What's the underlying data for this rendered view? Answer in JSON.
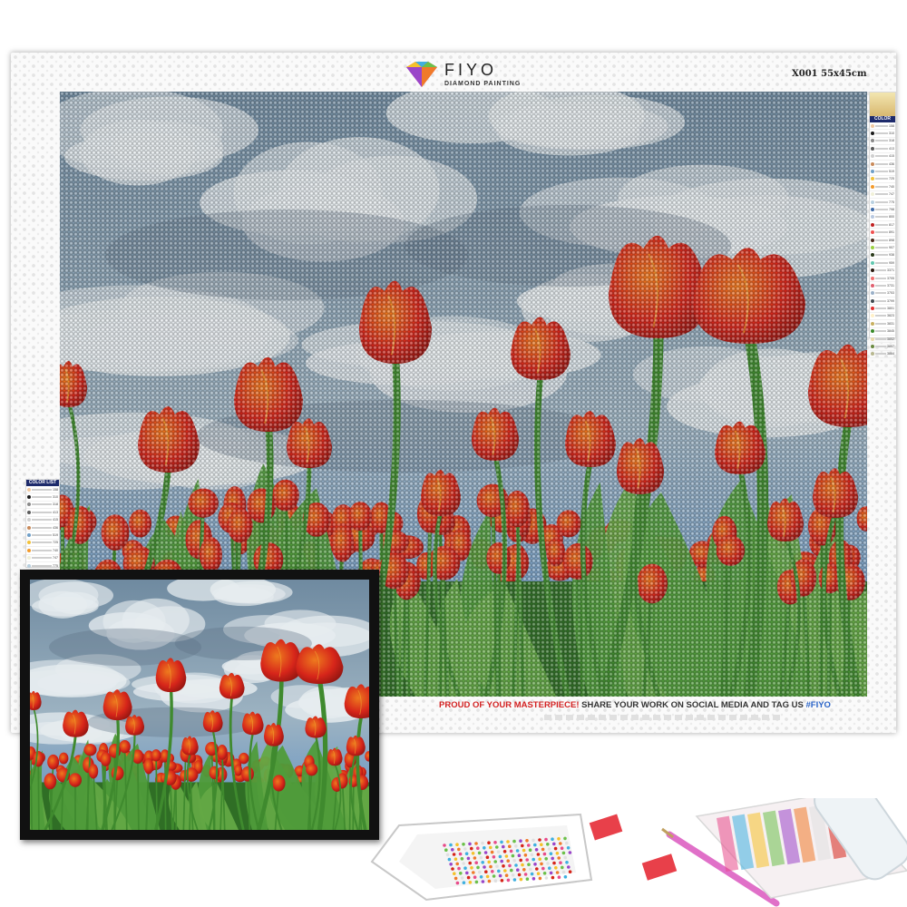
{
  "brand": {
    "name": "FIYO",
    "tagline": "DIAMOND PAINTING"
  },
  "canvas": {
    "size_label": "X001 55x45cm"
  },
  "footer": {
    "part1": "PROUD OF YOUR MASTERPIECE!",
    "part2": " SHARE YOUR WORK ON SOCIAL MEDIA AND TAG US ",
    "part3": "#FIYO"
  },
  "color_list": {
    "title": "COLOR LIST",
    "codes": [
      "158",
      "310",
      "318",
      "413",
      "415",
      "436",
      "519",
      "725",
      "740",
      "747",
      "775",
      "798",
      "800",
      "817",
      "891",
      "898",
      "907",
      "938",
      "959",
      "3371",
      "3705",
      "3731",
      "3753",
      "3799",
      "3801",
      "3823",
      "3831",
      "3845",
      "3852",
      "3857",
      "3864"
    ]
  },
  "colors": {
    "sky": "#7b96a8",
    "cloud": "#e6ecef",
    "tulip_red": "#d6251a",
    "tulip_orange": "#ee7a1e",
    "stem_green": "#3f8a2e",
    "leaf_green": "#4f9b3a",
    "footer_red": "#d32222",
    "footer_blue": "#2a64c8",
    "list_header": "#1d2a6b"
  }
}
